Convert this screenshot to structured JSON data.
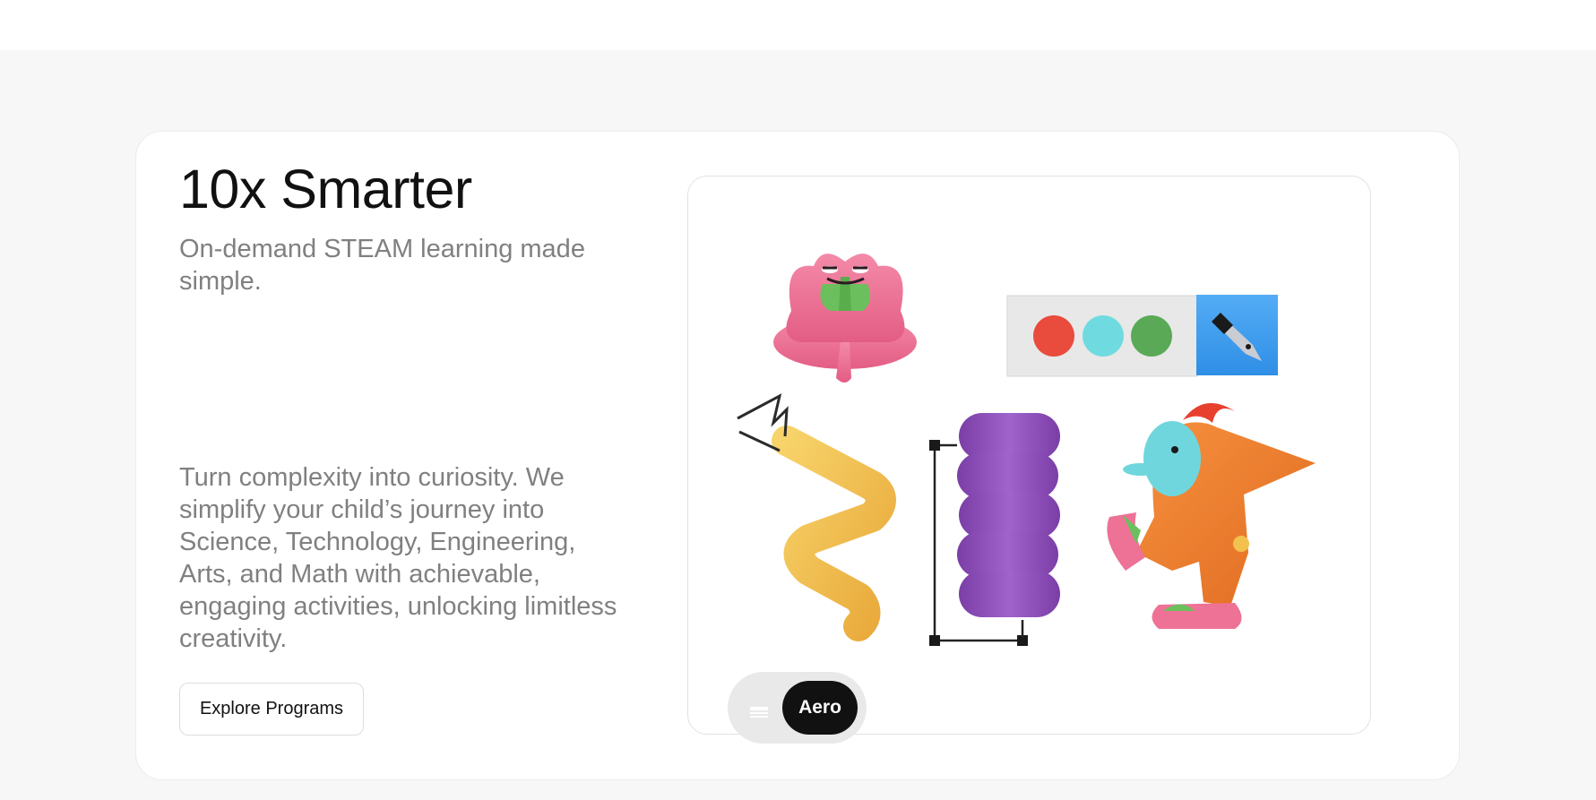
{
  "hero": {
    "title": "10x Smarter",
    "subtitle": "On-demand STEAM learning made simple.",
    "description": "Turn complexity into curiosity. We simplify your child’s journey into Science, Technology, Engineering, Arts, and Math with achievable, engaging activities, unlocking limitless creativity.",
    "cta_label": "Explore Programs"
  },
  "switcher": {
    "menu_icon": "menu-icon",
    "active_label": "Aero"
  },
  "colors": {
    "title": "#111111",
    "muted_text": "#808080",
    "page_background": "#f7f7f7",
    "card_background": "#ffffff",
    "pill_active": "#111111",
    "pill_track": "#e9e9e9",
    "pink_figure": "#ee6f93",
    "green_hands": "#6cbf5d",
    "yellow_spring": "#f2c14e",
    "purple_stack": "#8e4fb8",
    "orange_character": "#f07a2c",
    "cyan_face": "#6fd6dd",
    "red_hair": "#e8402f",
    "swatch_red": "#e94b3c",
    "swatch_cyan": "#6fdbe0",
    "swatch_green": "#5aa956",
    "pen_tool_blue": "#3d9df0"
  }
}
